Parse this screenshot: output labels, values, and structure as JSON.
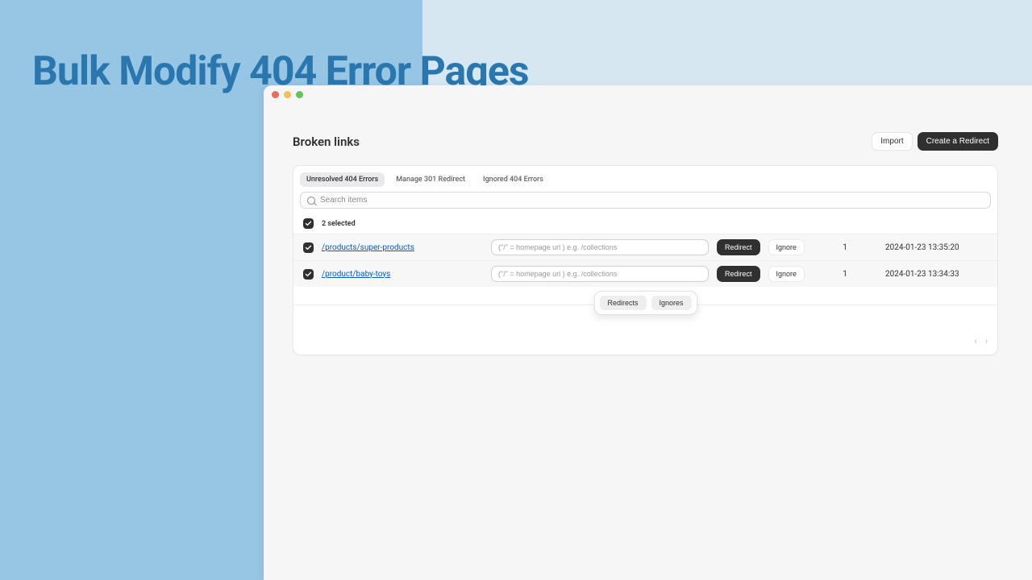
{
  "hero": {
    "title": "Bulk Modify 404 Error Pages"
  },
  "header": {
    "title": "Broken links",
    "import_label": "Import",
    "create_label": "Create a Redirect"
  },
  "tabs": {
    "items": [
      {
        "label": "Unresolved 404 Errors"
      },
      {
        "label": "Manage 301 Redirect"
      },
      {
        "label": "Ignored 404 Errors"
      }
    ]
  },
  "search": {
    "placeholder": "Search items"
  },
  "selection": {
    "summary": "2 selected"
  },
  "row_controls": {
    "redirect_label": "Redirect",
    "ignore_label": "Ignore",
    "placeholder": "(\"/\" = homepage url ) e.g. /collections"
  },
  "rows": [
    {
      "path": "/products/super-products",
      "count": "1",
      "timestamp": "2024-01-23 13:35:20"
    },
    {
      "path": "/product/baby-toys",
      "count": "1",
      "timestamp": "2024-01-23 13:34:33"
    }
  ],
  "bulk": {
    "redirects_label": "Redirects",
    "ignores_label": "Ignores"
  },
  "pager": {
    "prev": "‹",
    "next": "›"
  }
}
